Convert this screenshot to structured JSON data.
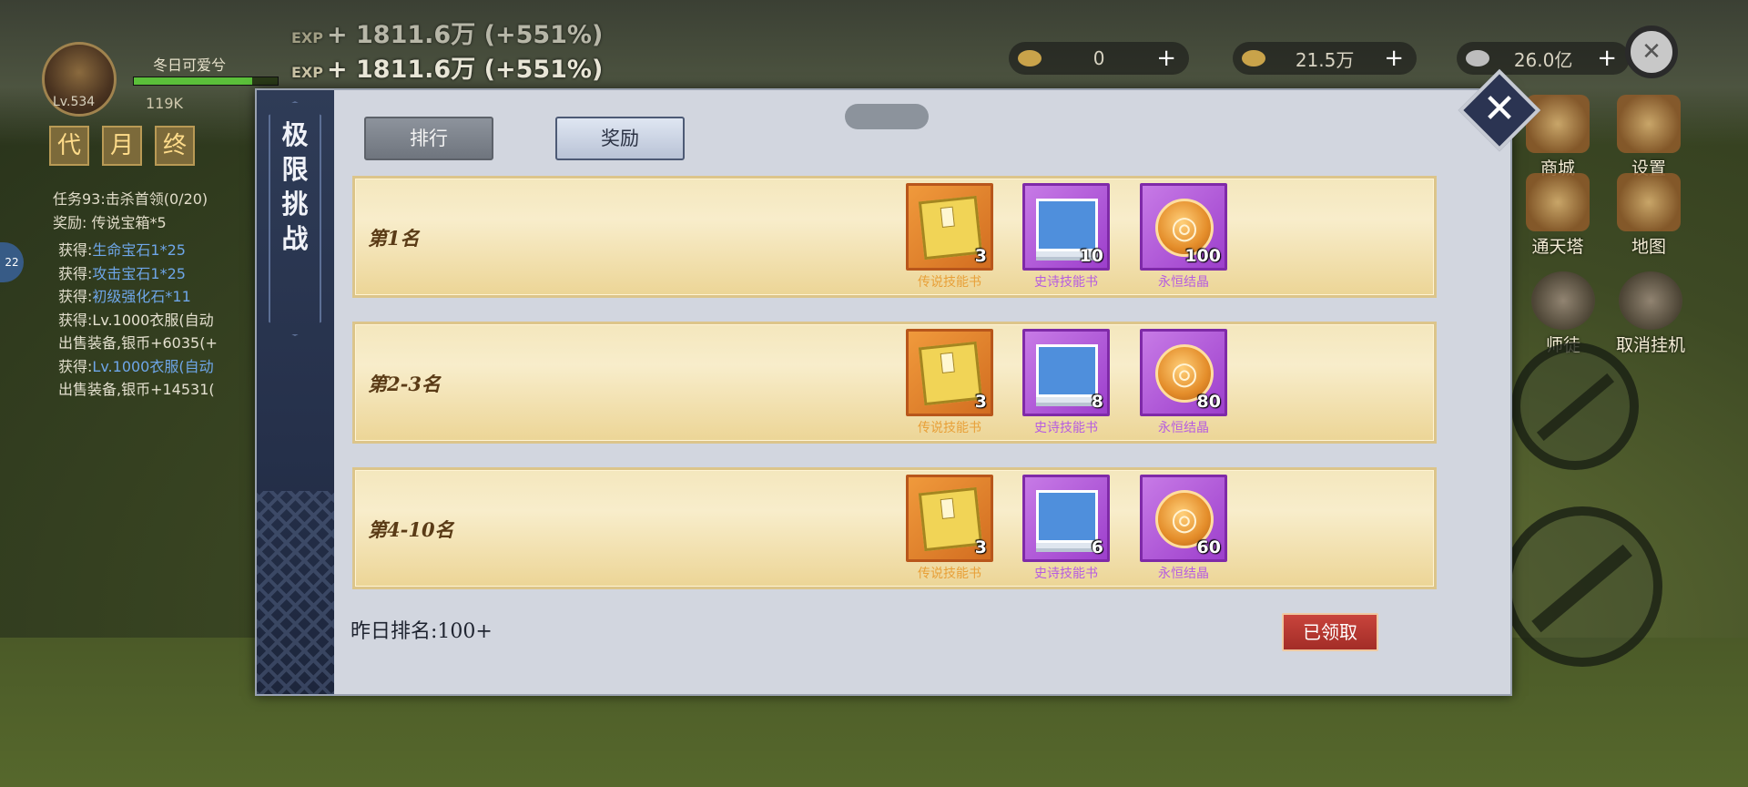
{
  "hud": {
    "exp_lines": [
      "+ 1811.6万 (+551%)",
      "+ 1811.6万 (+551%)"
    ],
    "exp_tag": "EXP",
    "player": {
      "name": "冬日可爱兮",
      "level": "Lv.534",
      "power": "119K",
      "hp_fraction": 0.82
    },
    "status_tags": [
      "代",
      "月",
      "终"
    ],
    "quest": {
      "line1": "任务93:击杀首领(0/20)",
      "line2": "奖励: 传说宝箱*5"
    },
    "log": [
      {
        "prefix": "获得:",
        "item": "生命宝石1*25"
      },
      {
        "prefix": "获得:",
        "item": "攻击宝石1*25"
      },
      {
        "prefix": "获得:",
        "item": "初级强化石*11"
      },
      {
        "prefix": "获得:",
        "item": "Lv.1000衣服(自动"
      },
      {
        "prefix": "出售装备,银币+6035(+",
        "item": ""
      },
      {
        "prefix": "获得:",
        "item": "Lv.1000衣服(自动"
      },
      {
        "prefix": "出售装备,银币+14531(",
        "item": ""
      }
    ],
    "side_badge": "22",
    "currencies": [
      {
        "value": "0",
        "plus": "+"
      },
      {
        "value": "21.5万",
        "plus": "+"
      },
      {
        "value": "26.0亿",
        "plus": "+"
      }
    ],
    "buttons": [
      {
        "label": "商城"
      },
      {
        "label": "设置"
      },
      {
        "label": "通天塔"
      },
      {
        "label": "地图"
      },
      {
        "label": "师徒"
      },
      {
        "label": "取消挂机"
      }
    ],
    "top_close": "✕"
  },
  "dialog": {
    "title_chars": [
      "极",
      "限",
      "挑",
      "战"
    ],
    "tabs": {
      "rank": "排行",
      "reward": "奖励"
    },
    "top_pill": "",
    "close_symbol": "✕",
    "rows": [
      {
        "label": "第1名",
        "items": [
          {
            "name": "传说技能书",
            "qty": "3",
            "icon": "gold-book-icon"
          },
          {
            "name": "史诗技能书",
            "qty": "10",
            "icon": "blue-book-icon"
          },
          {
            "name": "永恒结晶",
            "qty": "100",
            "icon": "crystal-coin-icon"
          }
        ]
      },
      {
        "label": "第2-3名",
        "items": [
          {
            "name": "传说技能书",
            "qty": "3",
            "icon": "gold-book-icon"
          },
          {
            "name": "史诗技能书",
            "qty": "8",
            "icon": "blue-book-icon"
          },
          {
            "name": "永恒结晶",
            "qty": "80",
            "icon": "crystal-coin-icon"
          }
        ]
      },
      {
        "label": "第4-10名",
        "items": [
          {
            "name": "传说技能书",
            "qty": "3",
            "icon": "gold-book-icon"
          },
          {
            "name": "史诗技能书",
            "qty": "6",
            "icon": "blue-book-icon"
          },
          {
            "name": "永恒结晶",
            "qty": "60",
            "icon": "crystal-coin-icon"
          }
        ]
      }
    ],
    "yesterday_rank": "昨日排名:100+",
    "claim_button": "已领取"
  },
  "colors": {
    "legendary_name": "#e8a038",
    "epic_name": "#b65ce0",
    "row_label": "#5a3b16",
    "claim_button": "#b3352e"
  }
}
